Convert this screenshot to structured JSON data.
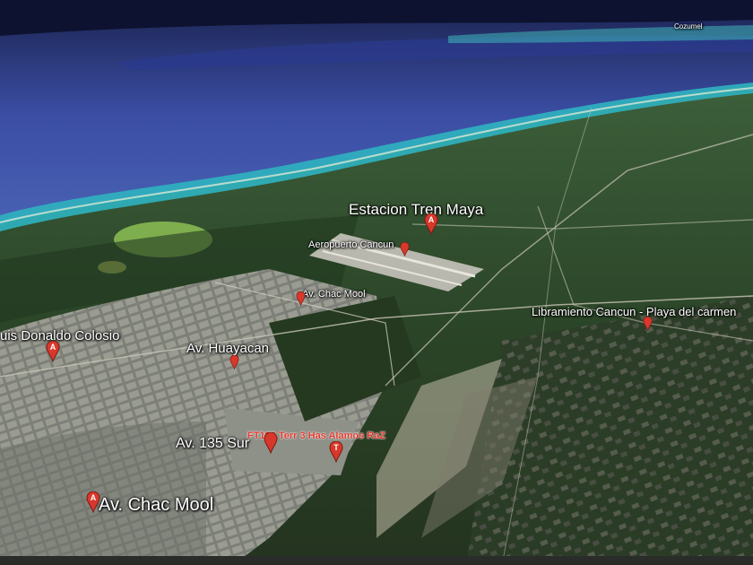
{
  "map": {
    "labels": {
      "cozumel": "Cozumel",
      "tren_maya": "Estacion Tren Maya",
      "aeropuerto": "Aeropuerto Cancun",
      "chac_mool_upper": "Av. Chac Mool",
      "colosio": "uis Donaldo Colosio",
      "huayacan": "Av. Huayacan",
      "libramiento": "Libramiento Cancun - Playa del carmen",
      "av_135": "Av. 135 Sur",
      "ft_lot": "FT196 Terr 3 Has Alamos RaZ",
      "chac_mool_lower": "Av. Chac Mool"
    },
    "pin_letters": {
      "tren_maya": "A",
      "colosio": "A",
      "ft_lot": "T",
      "chac_mool_lower": "A"
    },
    "colors": {
      "pin": "#d8382c",
      "ft_label": "#e23a2e",
      "sea": "#3a4fa0",
      "coast": "#2fb3c0",
      "land": "#2f4a2c"
    }
  }
}
